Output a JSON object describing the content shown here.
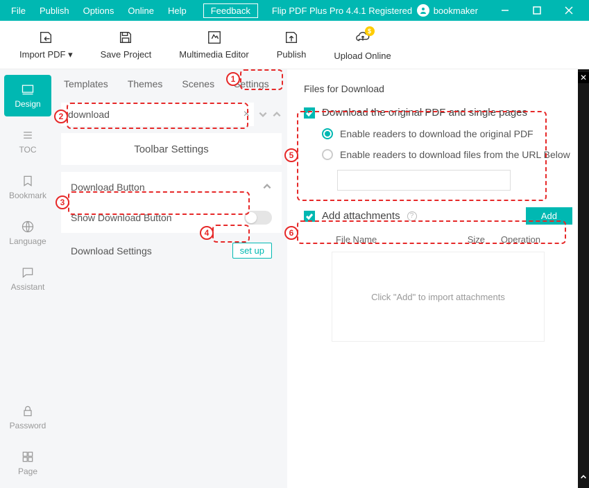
{
  "menu": {
    "file": "File",
    "publish": "Publish",
    "options": "Options",
    "online": "Online",
    "help": "Help",
    "feedback": "Feedback"
  },
  "app_title": "Flip PDF Plus Pro 4.4.1 Registered",
  "user": "bookmaker",
  "toolbar": {
    "import": "Import PDF ▾",
    "save": "Save Project",
    "multimedia": "Multimedia Editor",
    "publishbtn": "Publish",
    "upload": "Upload Online",
    "badge": "$"
  },
  "sidebar": {
    "design": "Design",
    "toc": "TOC",
    "bookmark": "Bookmark",
    "language": "Language",
    "assistant": "Assistant",
    "password": "Password",
    "page": "Page"
  },
  "tabs": {
    "templates": "Templates",
    "themes": "Themes",
    "scenes": "Scenes",
    "settings": "Settings"
  },
  "search": {
    "value": "download"
  },
  "sections": {
    "toolbar_settings": "Toolbar Settings",
    "download_button": "Download Button",
    "show_download": "Show Download Button",
    "download_settings": "Download Settings",
    "setup": "set up"
  },
  "right": {
    "title": "Files for Download",
    "chk1": "Download the original PDF and single pages",
    "r1": "Enable readers to download the original PDF",
    "r2": "Enable readers to download files from the URL Below",
    "chk2": "Add attachments",
    "add": "Add",
    "col1": "File Name",
    "col2": "Size",
    "col3": "Operation",
    "empty": "Click \"Add\" to import attachments"
  }
}
